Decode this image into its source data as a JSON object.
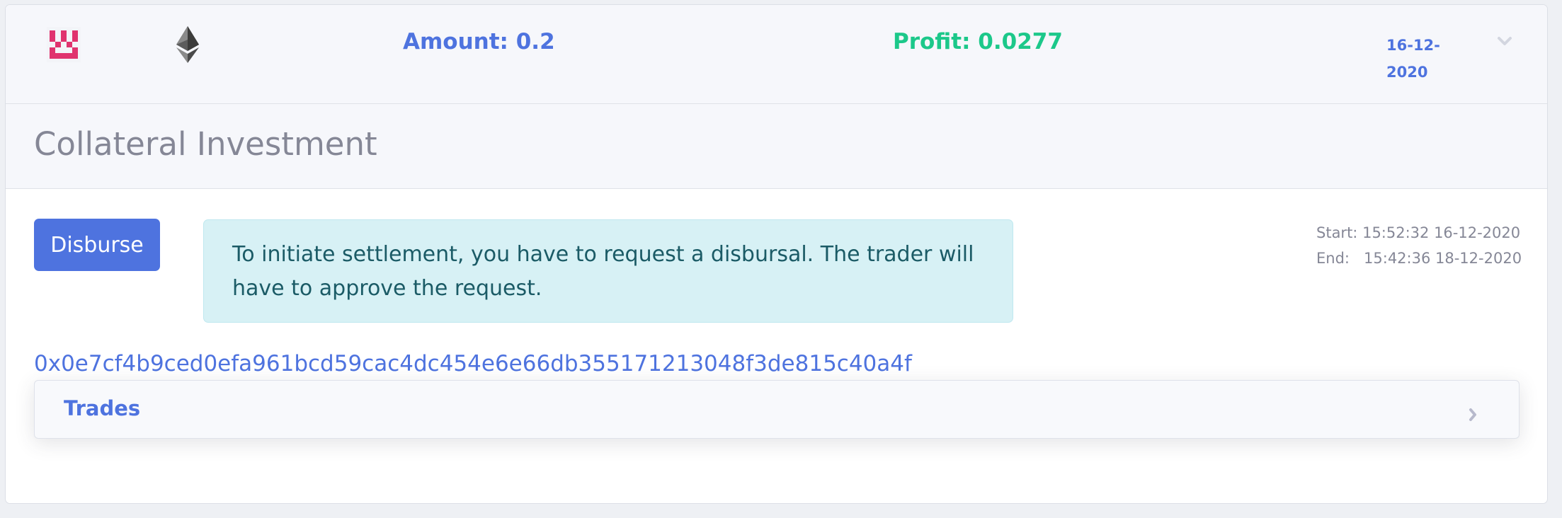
{
  "header": {
    "logo_icon": "pink-pixel-logo-icon",
    "currency_icon": "ethereum-icon",
    "amount": "Amount: 0.2",
    "profit": "Profit: 0.0277",
    "date_line1": "16-12-",
    "date_line2": "2020",
    "expand_icon": "chevron-down-icon"
  },
  "section": {
    "title": "Collateral Investment"
  },
  "actions": {
    "disburse_label": "Disburse"
  },
  "alert": {
    "message": "To initiate settlement, you have to request a disbursal. The trader will have to approve the request."
  },
  "times": {
    "start_label": "Start:",
    "start_value": "15:52:32 16-12-2020",
    "end_label": "End:",
    "end_value": "15:42:36 18-12-2020"
  },
  "contract": {
    "hash": "0x0e7cf4b9ced0efa961bcd59cac4dc454e6e66db355171213048f3de815c40a4f"
  },
  "trades": {
    "label": "Trades",
    "expand_icon": "chevron-right-icon"
  },
  "colors": {
    "primary": "#4e73df",
    "success": "#1cc88a",
    "info_bg": "#d7f1f5",
    "logo_pink": "#e0336e"
  }
}
